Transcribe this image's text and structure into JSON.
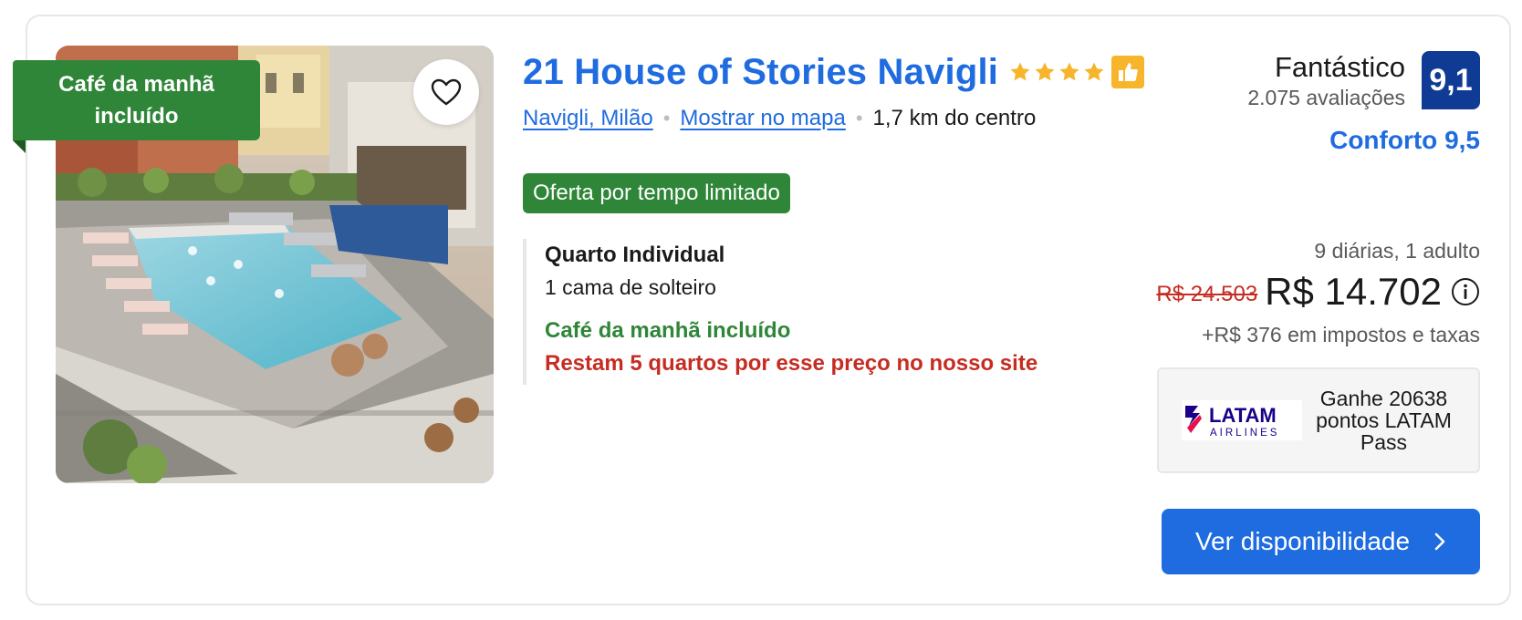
{
  "hotel": {
    "name": "21 House of Stories Navigli",
    "star_count": 4,
    "star_color": "#f6b52a",
    "preferred_badge_icon": "thumbs-up-icon",
    "location": "Navigli, Milão",
    "map_link": "Mostrar no mapa",
    "distance": "1,7 km do centro"
  },
  "photo": {
    "ribbon": "Café da manhã incluído",
    "favorite_icon": "heart-icon"
  },
  "offer_badge": "Oferta por tempo limitado",
  "room": {
    "name": "Quarto Individual",
    "bed": "1 cama de solteiro",
    "breakfast": "Café da manhã incluído",
    "scarcity": "Restam 5 quartos por esse preço no nosso site"
  },
  "review": {
    "label": "Fantástico",
    "count": "2.075 avaliações",
    "score": "9,1",
    "comfort": "Conforto 9,5"
  },
  "pricing": {
    "stay_info": "9 diárias, 1 adulto",
    "old_price": "R$ 24.503",
    "new_price": "R$ 14.702",
    "taxes": "+R$ 376 em impostos e taxas"
  },
  "loyalty": {
    "logo_top": "LATAM",
    "logo_bottom": "AIRLINES",
    "text": "Ganhe 20638 pontos LATAM Pass"
  },
  "cta": {
    "label": "Ver disponibilidade"
  },
  "colors": {
    "brand_blue": "#1f6ce0",
    "score_navy": "#0f3b94",
    "green": "#2f8638",
    "red": "#c62c22"
  }
}
